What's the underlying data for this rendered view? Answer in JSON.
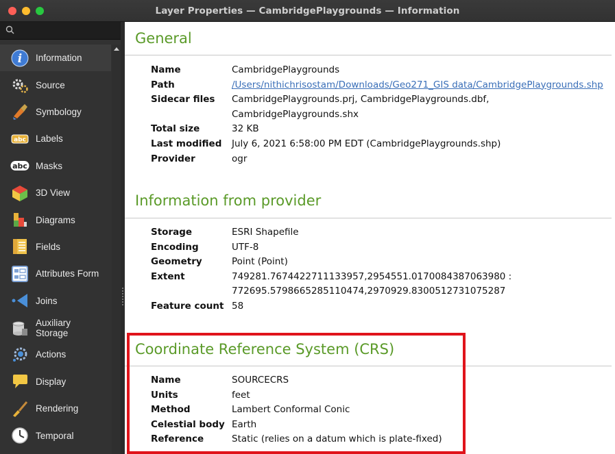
{
  "window": {
    "title": "Layer Properties — CambridgePlaygrounds — Information"
  },
  "sidebar": {
    "items": [
      {
        "label": "Information",
        "icon": "info-icon",
        "active": true
      },
      {
        "label": "Source",
        "icon": "source-icon"
      },
      {
        "label": "Symbology",
        "icon": "symbology-icon"
      },
      {
        "label": "Labels",
        "icon": "labels-icon"
      },
      {
        "label": "Masks",
        "icon": "masks-icon"
      },
      {
        "label": "3D View",
        "icon": "3d-view-icon"
      },
      {
        "label": "Diagrams",
        "icon": "diagrams-icon"
      },
      {
        "label": "Fields",
        "icon": "fields-icon"
      },
      {
        "label": "Attributes Form",
        "icon": "attributes-form-icon"
      },
      {
        "label": "Joins",
        "icon": "joins-icon"
      },
      {
        "label": "Auxiliary Storage",
        "icon": "auxiliary-storage-icon"
      },
      {
        "label": "Actions",
        "icon": "actions-icon"
      },
      {
        "label": "Display",
        "icon": "display-icon"
      },
      {
        "label": "Rendering",
        "icon": "rendering-icon"
      },
      {
        "label": "Temporal",
        "icon": "temporal-icon"
      }
    ],
    "icon_text": {
      "abc": "abc"
    }
  },
  "general": {
    "title": "General",
    "name_key": "Name",
    "name": "CambridgePlaygrounds",
    "path_key": "Path",
    "path": "/Users/nithichrisostam/Downloads/Geo271_GIS data/CambridgePlaygrounds.shp",
    "sidecar_key": "Sidecar files",
    "sidecar_1": "CambridgePlaygrounds.prj, CambridgePlaygrounds.dbf,",
    "sidecar_2": "CambridgePlaygrounds.shx",
    "size_key": "Total size",
    "size": "32 KB",
    "modified_key": "Last modified",
    "modified": "July 6, 2021 6:58:00 PM EDT (CambridgePlaygrounds.shp)",
    "provider_key": "Provider",
    "provider": "ogr"
  },
  "provider_info": {
    "title": "Information from provider",
    "storage_key": "Storage",
    "storage": "ESRI Shapefile",
    "encoding_key": "Encoding",
    "encoding": "UTF-8",
    "geometry_key": "Geometry",
    "geometry": "Point (Point)",
    "extent_key": "Extent",
    "extent_1": "749281.7674422711133957,2954551.0170084387063980 :",
    "extent_2": "772695.5798665285110474,2970929.8300512731075287",
    "count_key": "Feature count",
    "count": "58"
  },
  "crs": {
    "title": "Coordinate Reference System (CRS)",
    "name_key": "Name",
    "name": "SOURCECRS",
    "units_key": "Units",
    "units": "feet",
    "method_key": "Method",
    "method": "Lambert Conformal Conic",
    "body_key": "Celestial body",
    "body": "Earth",
    "reference_key": "Reference",
    "reference": "Static (relies on a datum which is plate-fixed)"
  },
  "colors": {
    "section_title": "#5a9a28",
    "link": "#3a6fb8",
    "highlight": "#e0141b"
  }
}
